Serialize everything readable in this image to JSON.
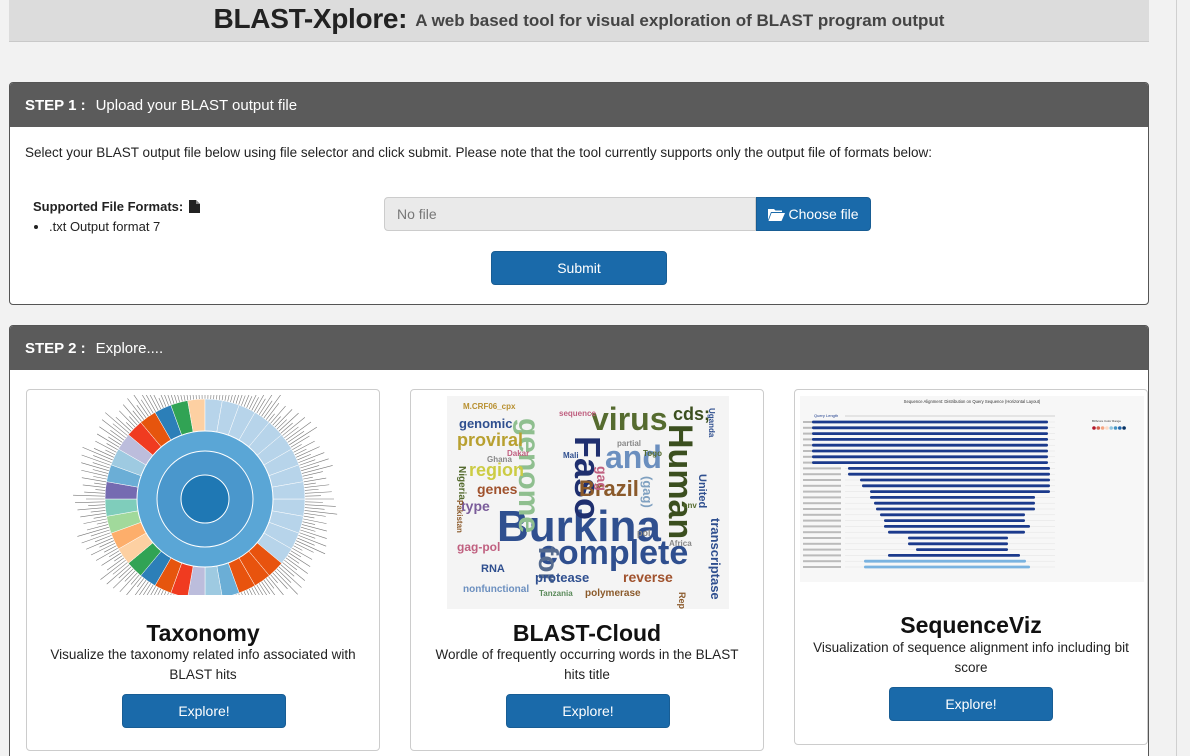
{
  "header": {
    "title": "BLAST-Xplore:",
    "subtitle": "A web based tool for visual exploration of BLAST program output"
  },
  "step1": {
    "step_label": "STEP 1 :",
    "heading": "Upload your BLAST output file",
    "instructions": "Select your BLAST output file below using file selector and click submit. Please note that the tool currently supports only the output file of formats below:",
    "formats_label": "Supported File Formats:",
    "formats": [
      ".txt Output format 7"
    ],
    "file_placeholder": "No file",
    "choose_label": "Choose file",
    "submit_label": "Submit"
  },
  "step2": {
    "step_label": "STEP 2 :",
    "heading": "Explore....",
    "cards": [
      {
        "title": "Taxonomy",
        "description": "Visualize the taxonomy related info associated with BLAST hits",
        "button": "Explore!"
      },
      {
        "title": "BLAST-Cloud",
        "description": "Wordle of frequently occurring words in the BLAST hits title",
        "button": "Explore!"
      },
      {
        "title": "SequenceViz",
        "description": "Visualization of sequence alignment info including bit score",
        "button": "Explore!"
      }
    ]
  },
  "wordcloud": {
    "words": [
      "Burkina",
      "complete",
      "Faso",
      "Human",
      "virus",
      "and",
      "genome",
      "Brazil",
      "for",
      "proviral",
      "genomic",
      "region",
      "genes",
      "protease",
      "reverse",
      "transcriptase",
      "gag-pol",
      "type",
      "RNA",
      "cds;",
      "United",
      "nonfunctional",
      "polymerase",
      "Nigeria",
      "sequence",
      "(gag)",
      "M.CRF06_cpx",
      "Tanzania",
      "Republic",
      "Uganda",
      "partial",
      "gag",
      "pol",
      "env",
      "Pakistan",
      "Africa",
      "Dakar",
      "Ghana",
      "Togo",
      "Mali"
    ]
  },
  "seqviz": {
    "title": "Sequence Alignment: Distribution on Query Sequence (Horizontal Layout)",
    "query_label": "Query Length",
    "scale_label": "BitScore Color Range"
  },
  "colors": {
    "primary_button": "#1a6aaa",
    "panel_header": "#5b5b5b",
    "header_bar": "#dcdcdc"
  }
}
